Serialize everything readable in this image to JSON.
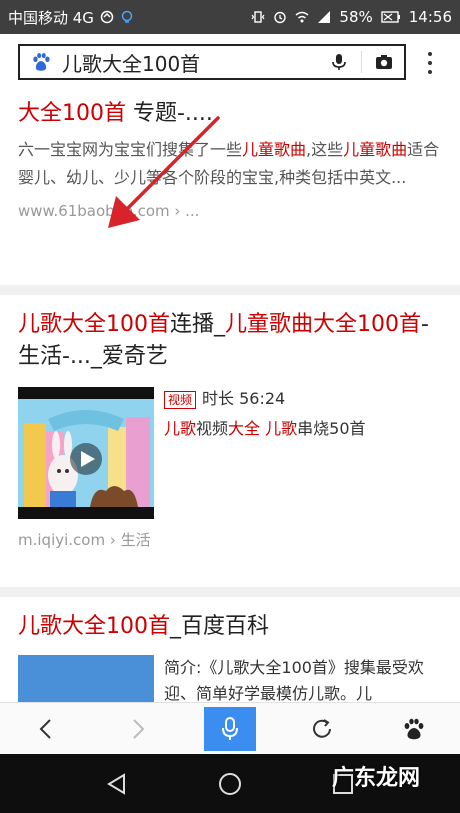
{
  "status_bar": {
    "carrier": "中国移动 4G",
    "battery": "58%",
    "time": "14:56"
  },
  "search": {
    "query": "儿歌大全100首"
  },
  "results": [
    {
      "title_hl": "大全100首",
      "title_rest": " 专题-....",
      "desc_1": "六一宝宝网为宝宝们搜集了一些",
      "desc_hl1": "儿童歌曲",
      "desc_2": ",这些",
      "desc_hl2": "儿童歌曲",
      "desc_3": "适合婴儿、幼儿、少儿等各个阶段的宝宝,种类包括中英文...",
      "url": "www.61baobao.com › ..."
    },
    {
      "title_hl1": "儿歌大全100首",
      "title_mid": "连播_",
      "title_hl2": "儿童歌曲大全100首",
      "title_rest": "-生活-..._爱奇艺",
      "tag": "视频",
      "duration": "时长 56:24",
      "line2_hl1": "儿歌",
      "line2_mid1": "视频",
      "line2_hl2": "大全",
      "line2_sp": " ",
      "line2_hl3": "儿歌",
      "line2_end": "串烧50首",
      "url": "m.iqiyi.com › 生活"
    },
    {
      "title_hl": "儿歌大全100首",
      "title_rest": "_百度百科",
      "snippet": "简介:《儿歌大全100首》搜集最受欢迎、简单好学最模仿儿歌。儿"
    }
  ],
  "watermark": "广东龙网",
  "colors": {
    "highlight": "#cc0000",
    "status_bar": "#3f3f3f",
    "mic_button": "#3b8ef0",
    "arrow": "#d8232a"
  }
}
